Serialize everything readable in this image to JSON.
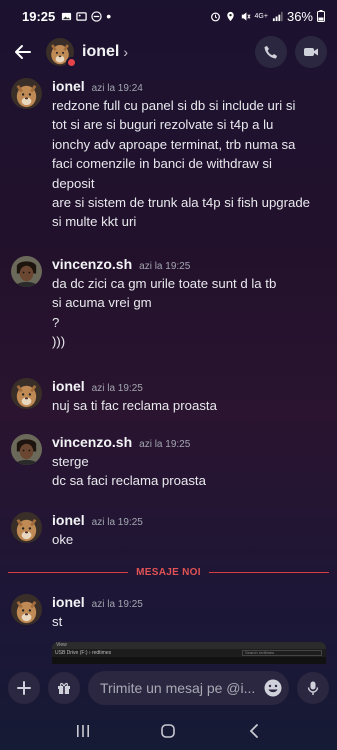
{
  "status_bar": {
    "time": "19:25",
    "battery": "36%",
    "network": "4G+"
  },
  "header": {
    "title": "ionel",
    "chevron": "›"
  },
  "messages": [
    {
      "author": "ionel",
      "timestamp": "azi la 19:24",
      "avatar": "cougar",
      "lines": [
        "redzone full cu panel si db si include uri si",
        "tot si are si buguri rezolvate si t4p a lu",
        "ionchy adv aproape terminat, trb numa sa",
        "faci comenzile in banci de withdraw si",
        "deposit",
        "are si sistem de trunk ala t4p si fish upgrade",
        "si multe kkt uri"
      ]
    },
    {
      "author": "vincenzo.sh",
      "timestamp": "azi la 19:25",
      "avatar": "person",
      "lines": [
        "da dc zici ca gm urile toate sunt d la tb",
        "si acuma vrei gm",
        "?",
        ")))"
      ]
    },
    {
      "author": "ionel",
      "timestamp": "azi la 19:25",
      "avatar": "cougar",
      "lines": [
        "nuj sa ti fac reclama proasta"
      ]
    },
    {
      "author": "vincenzo.sh",
      "timestamp": "azi la 19:25",
      "avatar": "person",
      "lines": [
        "sterge",
        "dc sa faci reclama proasta"
      ]
    },
    {
      "author": "ionel",
      "timestamp": "azi la 19:25",
      "avatar": "cougar",
      "lines": [
        "oke"
      ]
    },
    {
      "author": "ionel",
      "timestamp": "azi la 19:25",
      "avatar": "cougar",
      "lines": [
        "st"
      ]
    }
  ],
  "new_messages_label": "MESAJE NOI",
  "attachment": {
    "menu_text": "View",
    "path_text": "USB Drive (F:) › redtimes",
    "search_text": "Search redtimes"
  },
  "composer": {
    "placeholder": "Trimite un mesaj pe @i..."
  },
  "colors": {
    "accent_red": "#e05254",
    "button_bg": "#2c2740"
  }
}
